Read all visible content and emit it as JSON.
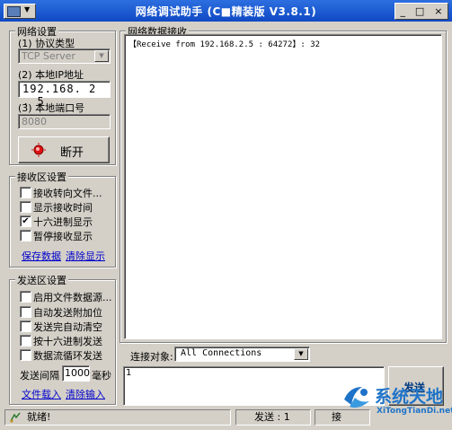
{
  "window": {
    "title": "网络调试助手 (C■精装版 V3.8.1)",
    "controls": [
      "_",
      "□",
      "×"
    ]
  },
  "network_settings": {
    "title": "网络设置",
    "protocol_label": "(1) 协议类型",
    "protocol_value": "TCP Server",
    "ip_label": "(2) 本地IP地址",
    "ip_value": "192.168. 2 . 5",
    "port_label": "(3) 本地端口号",
    "port_value": "8080",
    "disconnect_button": "断开"
  },
  "receive_settings": {
    "title": "接收区设置",
    "options": [
      {
        "label": "接收转向文件...",
        "checked": false
      },
      {
        "label": "显示接收时间",
        "checked": false
      },
      {
        "label": "十六进制显示",
        "checked": true
      },
      {
        "label": "暂停接收显示",
        "checked": false
      }
    ],
    "save_link": "保存数据",
    "clear_link": "清除显示"
  },
  "send_settings": {
    "title": "发送区设置",
    "options": [
      {
        "label": "启用文件数据源...",
        "checked": false
      },
      {
        "label": "自动发送附加位",
        "checked": false
      },
      {
        "label": "发送完自动清空",
        "checked": false
      },
      {
        "label": "按十六进制发送",
        "checked": false
      },
      {
        "label": "数据流循环发送",
        "checked": false
      }
    ],
    "interval_label": "发送间隔",
    "interval_value": "1000",
    "interval_unit": "毫秒",
    "load_file_link": "文件载入",
    "clear_input_link": "清除输入"
  },
  "receive_area": {
    "title": "网络数据接收",
    "content": "【Receive from 192.168.2.5 : 64272】: 32"
  },
  "connection": {
    "label": "连接对象:",
    "value": "All Connections"
  },
  "send_area": {
    "content": "1",
    "send_button": "发送"
  },
  "status_bar": {
    "status": "就绪!",
    "send_count": "发送 : 1",
    "recv_count": "接"
  },
  "watermark": {
    "brand": "系统天地",
    "url": "XiTongTianDi.net"
  },
  "colors": {
    "titlebar": "#0f49c4",
    "face": "#d4d0c8",
    "link": "#0000cc",
    "watermark": "#1e73c8"
  }
}
